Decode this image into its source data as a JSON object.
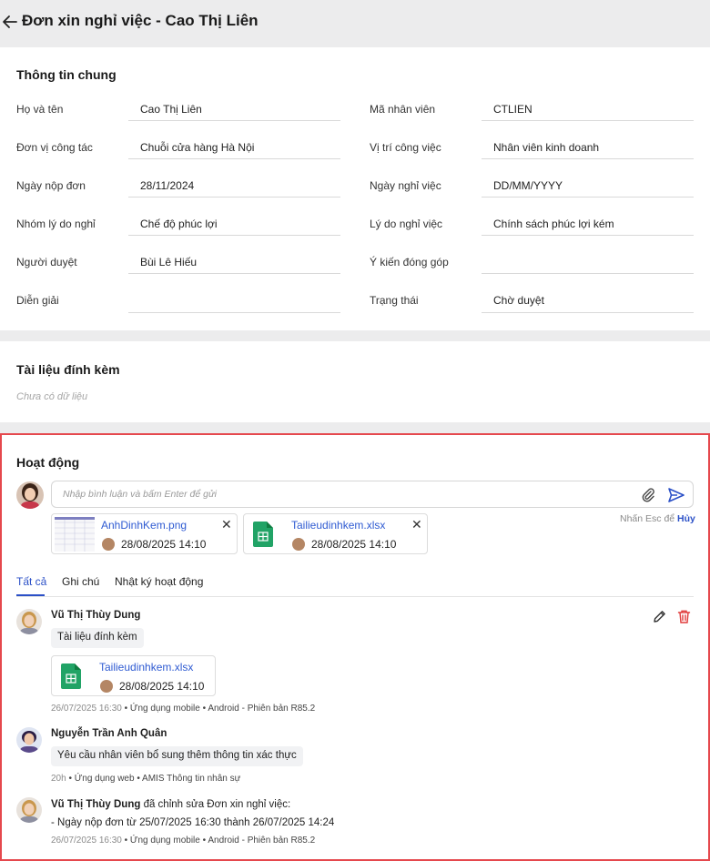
{
  "header": {
    "title": "Đơn xin nghỉ việc - Cao Thị Liên"
  },
  "general": {
    "title": "Thông tin chung",
    "left": [
      {
        "label": "Họ và tên",
        "value": "Cao Thị Liên"
      },
      {
        "label": "Đơn vị công tác",
        "value": "Chuỗi cửa hàng Hà Nội"
      },
      {
        "label": "Ngày nộp đơn",
        "value": "28/11/2024"
      },
      {
        "label": "Nhóm lý do nghỉ",
        "value": "Chế độ phúc lợi"
      },
      {
        "label": "Người duyệt",
        "value": "Bùi Lê Hiếu"
      },
      {
        "label": "Diễn giải",
        "value": ""
      }
    ],
    "right": [
      {
        "label": "Mã nhân viên",
        "value": "CTLIEN"
      },
      {
        "label": "Vị trí công việc",
        "value": "Nhân viên kinh doanh"
      },
      {
        "label": "Ngày nghỉ việc",
        "value": "DD/MM/YYYY"
      },
      {
        "label": "Lý do nghỉ việc",
        "value": "Chính sách phúc lợi kém"
      },
      {
        "label": "Ý kiến đóng góp",
        "value": ""
      },
      {
        "label": "Trạng thái",
        "value": "Chờ duyệt"
      }
    ]
  },
  "attachments": {
    "title": "Tài liệu đính kèm",
    "empty_text": "Chưa có dữ liệu"
  },
  "activity": {
    "title": "Hoạt động",
    "comment_placeholder": "Nhập bình luận và bấm Enter để gửi",
    "esc_hint": "Nhấn Esc để",
    "cancel_label": "Hủy",
    "pending_files": [
      {
        "name": "AnhDinhKem.png",
        "date": "28/08/2025 14:10"
      },
      {
        "name": "Tailieudinhkem.xlsx",
        "date": "28/08/2025 14:10"
      }
    ],
    "tabs": [
      "Tất cả",
      "Ghi chú",
      "Nhật ký hoạt động"
    ],
    "items": [
      {
        "author": "Vũ Thị Thùy Dung",
        "note": "Tài liệu đính kèm",
        "file_name": "Tailieudinhkem.xlsx",
        "file_date": "28/08/2025 14:10",
        "time": "26/07/2025 16:30",
        "meta": " • Ứng dụng mobile • Android - Phiên bản R85.2"
      },
      {
        "author": "Nguyễn Trần Anh Quân",
        "note": "Yêu cầu nhân viên bổ sung thêm thông tin xác thực",
        "time": "20h",
        "meta": " • Ứng dụng web • AMIS Thông tin nhân sự"
      },
      {
        "author": "Vũ Thị Thùy Dung",
        "action": " đã chỉnh sửa Đơn xin nghỉ việc:",
        "detail": "- Ngày nộp đơn từ 25/07/2025 16:30 thành 26/07/2025 14:24",
        "time": "26/07/2025 16:30",
        "meta": " • Ứng dụng mobile • Android - Phiên bản R85.2"
      }
    ]
  },
  "colors": {
    "accent": "#2b50c7",
    "danger": "#e5484d",
    "excel": "#21a366"
  }
}
